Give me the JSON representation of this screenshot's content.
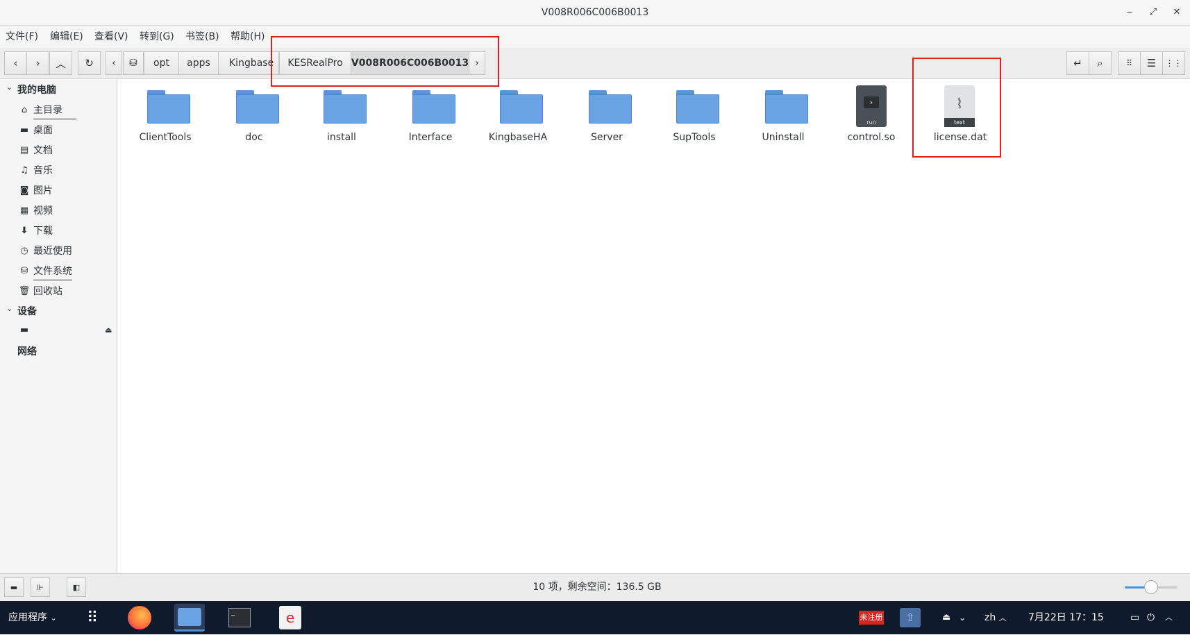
{
  "window": {
    "title": "V008R006C006B0013"
  },
  "menubar": {
    "items": [
      "文件(F)",
      "编辑(E)",
      "查看(V)",
      "转到(G)",
      "书签(B)",
      "帮助(H)"
    ]
  },
  "breadcrumb": {
    "items": [
      "opt",
      "apps",
      "Kingbase",
      "KESRealPro",
      "V008R006C006B0013"
    ],
    "active": "V008R006C006B0013"
  },
  "sidebar": {
    "section_computer": "我的电脑",
    "items": [
      "主目录",
      "桌面",
      "文档",
      "音乐",
      "图片",
      "视频",
      "下载",
      "最近使用",
      "文件系统",
      "回收站"
    ],
    "section_devices": "设备",
    "section_network": "网络"
  },
  "files": [
    {
      "name": "ClientTools",
      "type": "folder"
    },
    {
      "name": "doc",
      "type": "folder"
    },
    {
      "name": "install",
      "type": "folder"
    },
    {
      "name": "Interface",
      "type": "folder"
    },
    {
      "name": "KingbaseHA",
      "type": "folder"
    },
    {
      "name": "Server",
      "type": "folder"
    },
    {
      "name": "SupTools",
      "type": "folder"
    },
    {
      "name": "Uninstall",
      "type": "folder"
    },
    {
      "name": "control.so",
      "type": "executable",
      "badge": "run"
    },
    {
      "name": "license.dat",
      "type": "text",
      "badge": "text"
    }
  ],
  "statusbar": {
    "text": "10 项，剩余空间：136.5 GB"
  },
  "taskbar": {
    "apps_menu": "应用程序",
    "unregistered_badge": "未注册",
    "input_method": "zh",
    "clock": "7月22日 17：15"
  },
  "colors": {
    "highlight_box": "#e02020",
    "folder": "#6aa3e3",
    "taskbar": "#0f1a2c"
  }
}
